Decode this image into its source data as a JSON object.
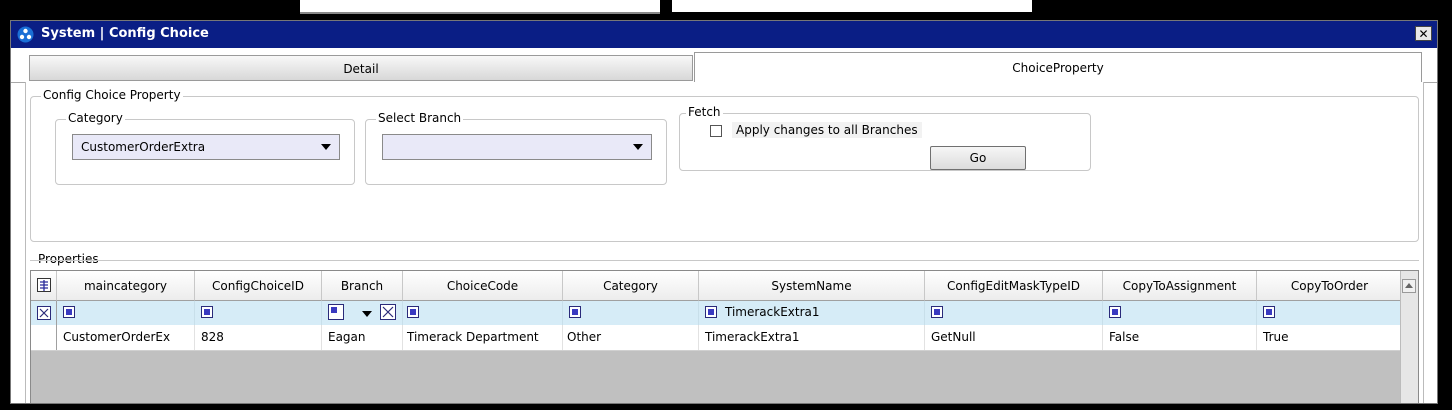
{
  "window": {
    "title": "System | Config Choice",
    "close_label": "✕"
  },
  "tabs": [
    {
      "label": "Detail"
    },
    {
      "label": "ChoiceProperty"
    }
  ],
  "config_group": {
    "legend": "Config Choice Property",
    "category": {
      "legend": "Category",
      "value": "CustomerOrderExtra"
    },
    "branch": {
      "legend": "Select Branch",
      "value": ""
    },
    "fetch": {
      "legend": "Fetch",
      "apply_label": "Apply changes to all Branches",
      "go_label": "Go"
    }
  },
  "properties": {
    "legend": "Properties",
    "columns": [
      "maincategory",
      "ConfigChoiceID",
      "Branch",
      "ChoiceCode",
      "Category",
      "SystemName",
      "ConfigEditMaskTypeID",
      "CopyToAssignment",
      "CopyToOrder"
    ],
    "filter": {
      "systemname": "TimerackExtra1"
    },
    "rows": [
      {
        "maincategory": "CustomerOrderEx",
        "configchoiceid": "828",
        "branch": "Eagan",
        "choicecode": "Timerack Department",
        "category": "Other",
        "systemname": "TimerackExtra1",
        "configeditmasktypeid": "GetNull",
        "copytoassignment": "False",
        "copytoorder": "True"
      }
    ]
  }
}
